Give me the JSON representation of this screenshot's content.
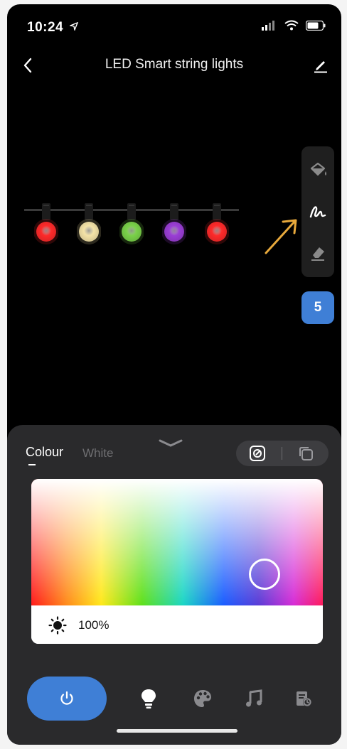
{
  "status": {
    "time": "10:24"
  },
  "nav": {
    "title": "LED Smart string lights"
  },
  "bulbs": [
    {
      "color": "#ff2a2a"
    },
    {
      "color": "#f4e3a8"
    },
    {
      "color": "#7ad24a"
    },
    {
      "color": "#9b3fd6"
    },
    {
      "color": "#ff2a2a"
    }
  ],
  "tools": [
    "paint-bucket-icon",
    "draw-icon",
    "eraser-icon"
  ],
  "count": "5",
  "panel": {
    "tab_colour": "Colour",
    "tab_white": "White",
    "brightness": "100%"
  },
  "picker": {
    "hue": 0.8,
    "saturation": 0.75
  },
  "colors": {
    "accent": "#3f7fd6",
    "annotation": "#e8a93c"
  }
}
